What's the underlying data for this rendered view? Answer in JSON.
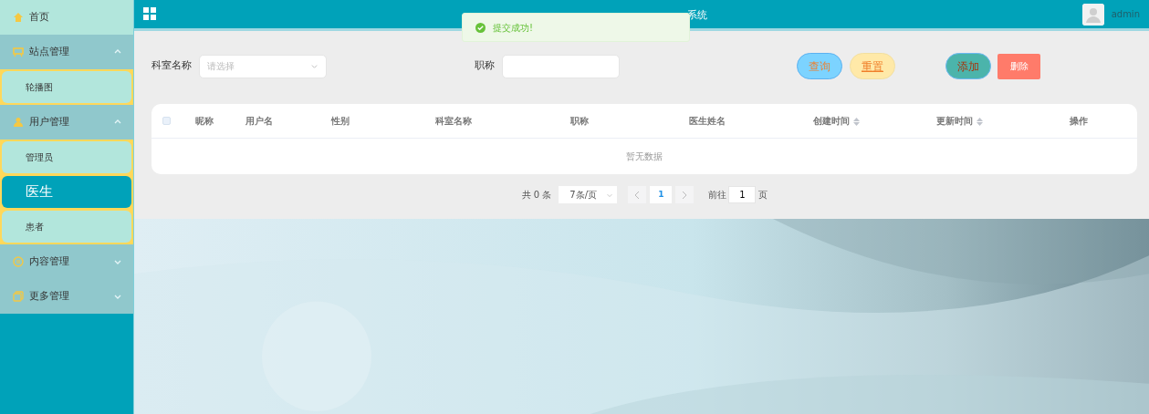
{
  "sidebar": {
    "items": [
      {
        "label": "首页",
        "kind": "link"
      },
      {
        "label": "站点管理",
        "kind": "group",
        "expanded": true,
        "children": [
          {
            "label": "轮播图",
            "selected": false
          }
        ]
      },
      {
        "label": "用户管理",
        "kind": "group",
        "expanded": true,
        "children": [
          {
            "label": "管理员",
            "selected": false
          },
          {
            "label": "医生",
            "selected": true
          },
          {
            "label": "患者",
            "selected": false
          }
        ]
      },
      {
        "label": "内容管理",
        "kind": "group",
        "expanded": false
      },
      {
        "label": "更多管理",
        "kind": "group",
        "expanded": false
      }
    ]
  },
  "header": {
    "title": "系统",
    "user": "admin"
  },
  "toast": {
    "message": "提交成功!"
  },
  "search": {
    "fields": [
      {
        "label": "科室名称",
        "kind": "select",
        "placeholder": "请选择"
      },
      {
        "label": "职称",
        "kind": "input"
      }
    ],
    "buttons": [
      {
        "label": "查询",
        "kind": "query"
      },
      {
        "label": "重置",
        "kind": "reset"
      },
      {
        "label": "添加",
        "kind": "add"
      },
      {
        "label": "删除",
        "kind": "delete"
      }
    ]
  },
  "table": {
    "select_all": {
      "checked": false
    },
    "columns": [
      {
        "label": "昵称",
        "sortable": false
      },
      {
        "label": "用户名",
        "sortable": false
      },
      {
        "label": "性别",
        "sortable": false
      },
      {
        "label": "科室名称",
        "sortable": false
      },
      {
        "label": "职称",
        "sortable": false
      },
      {
        "label": "医生姓名",
        "sortable": false
      },
      {
        "label": "创建时间",
        "sortable": true
      },
      {
        "label": "更新时间",
        "sortable": true
      },
      {
        "label": "操作",
        "sortable": false
      }
    ],
    "empty_text": "暂无数据"
  },
  "pagination": {
    "total": "共 0 条",
    "page_size": "7条/页",
    "pages": [
      {
        "label": "1",
        "selected": true
      }
    ],
    "goto_label": "前往",
    "goto_value": "1",
    "goto_suffix": "页"
  }
}
